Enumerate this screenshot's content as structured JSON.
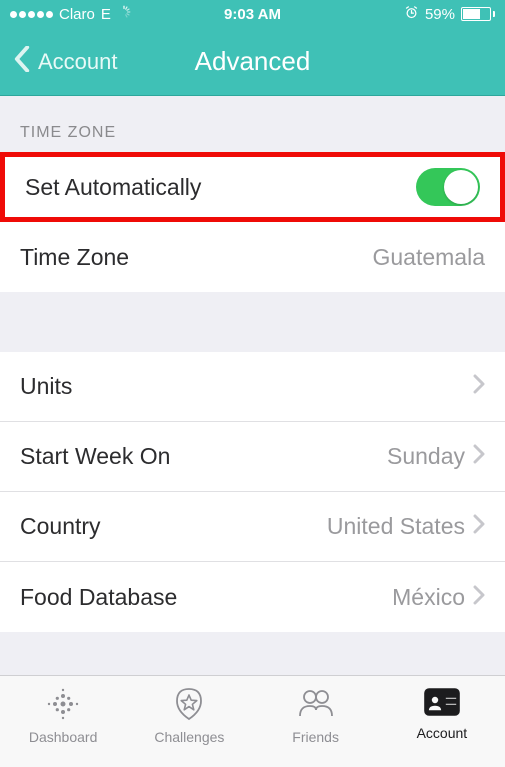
{
  "status_bar": {
    "carrier": "Claro",
    "network": "E",
    "time": "9:03 AM",
    "battery_percent": "59%",
    "battery_level": 0.59,
    "alarm": true
  },
  "nav": {
    "back_label": "Account",
    "title": "Advanced"
  },
  "sections": {
    "time_zone_header": "TIME ZONE",
    "rows": {
      "set_automatically": {
        "label": "Set Automatically",
        "on": true
      },
      "time_zone": {
        "label": "Time Zone",
        "value": "Guatemala"
      },
      "units": {
        "label": "Units"
      },
      "start_week_on": {
        "label": "Start Week On",
        "value": "Sunday"
      },
      "country": {
        "label": "Country",
        "value": "United States"
      },
      "food_database": {
        "label": "Food Database",
        "value": "México"
      }
    }
  },
  "tabs": {
    "dashboard": "Dashboard",
    "challenges": "Challenges",
    "friends": "Friends",
    "account": "Account",
    "active": "account"
  },
  "colors": {
    "accent": "#3fc1b6",
    "toggle_on": "#34c759",
    "highlight": "#ef0b07"
  }
}
